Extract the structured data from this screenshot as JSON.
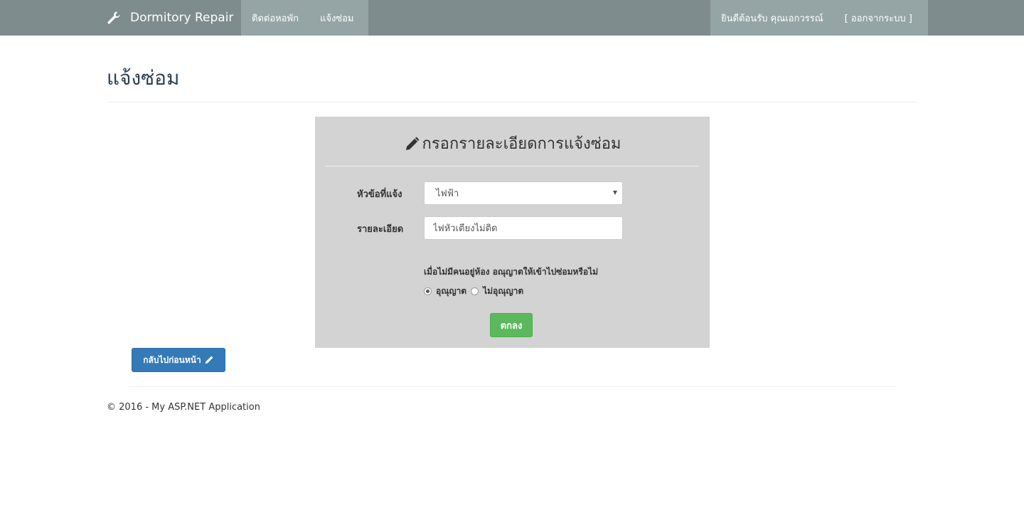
{
  "navbar": {
    "brand": "Dormitory Repair",
    "brand_icon": "wrench-icon",
    "left_items": [
      {
        "label": "ติดต่อหอพัก"
      },
      {
        "label": "แจ้งซ่อม"
      }
    ],
    "welcome": "ยินดีต้อนรับ คุณเอกวรรณ์",
    "logout": "[ ออกจากระบบ ]"
  },
  "page": {
    "title": "แจ้งซ่อม"
  },
  "form": {
    "title": "กรอกรายละเอียดการแจ้งซ่อม",
    "title_icon": "pencil-icon",
    "topic_label": "หัวข้อที่แจ้ง",
    "topic_value": "ไฟฟ้า",
    "detail_label": "รายละเอียด",
    "detail_value": "ไฟหัวเตียงไม่ติด",
    "permission_question": "เมื่อไม่มีคนอยู่ห้อง อณุญาตให้เข้าไปซ่อมหรือไม่",
    "options": [
      {
        "label": "อุณุญาต",
        "checked": true
      },
      {
        "label": "ไม่อุณุญาต",
        "checked": false
      }
    ],
    "submit_label": "ตกลง"
  },
  "back_button": {
    "label": "กลับไปก่อนหน้า",
    "icon": "pencil-icon"
  },
  "footer": {
    "text": "© 2016 - My ASP.NET Application"
  },
  "colors": {
    "navbar": "#7f8c8d",
    "nav_highlight": "#95a5a6",
    "panel": "#d3d3d3",
    "success": "#5cb85c",
    "primary": "#337ab7"
  }
}
